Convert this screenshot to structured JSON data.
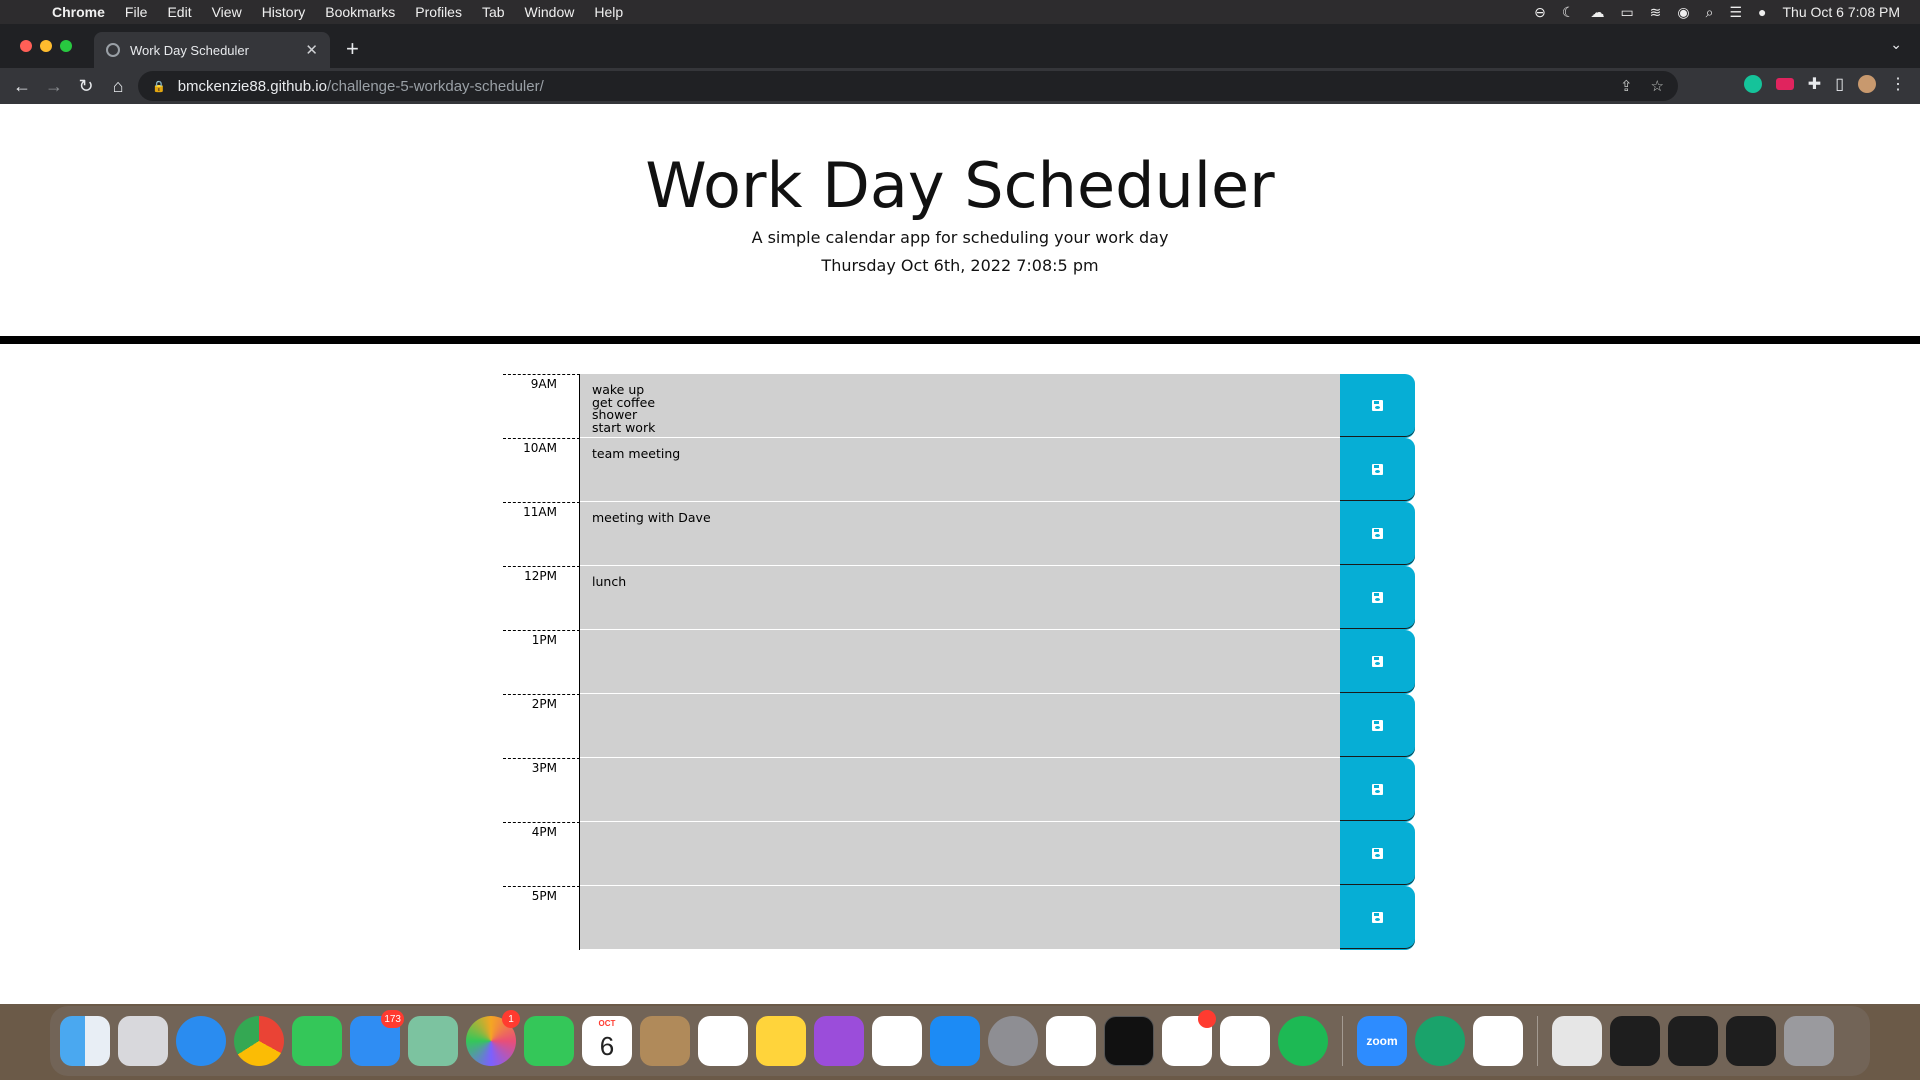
{
  "menubar": {
    "app_name": "Chrome",
    "items": [
      "File",
      "Edit",
      "View",
      "History",
      "Bookmarks",
      "Profiles",
      "Tab",
      "Window",
      "Help"
    ],
    "clock": "Thu Oct 6  7:08 PM"
  },
  "browser": {
    "tab_title": "Work Day Scheduler",
    "url_domain": "bmckenzie88.github.io",
    "url_path": "/challenge-5-workday-scheduler/"
  },
  "page": {
    "title": "Work Day Scheduler",
    "subtitle": "A simple calendar app for scheduling your work day",
    "datetime": "Thursday Oct 6th, 2022 7:08:5 pm"
  },
  "schedule": [
    {
      "hour": "9AM",
      "text": "wake up\nget coffee\nshower\nstart work"
    },
    {
      "hour": "10AM",
      "text": "team meeting"
    },
    {
      "hour": "11AM",
      "text": "meeting with Dave"
    },
    {
      "hour": "12PM",
      "text": "lunch"
    },
    {
      "hour": "1PM",
      "text": ""
    },
    {
      "hour": "2PM",
      "text": ""
    },
    {
      "hour": "3PM",
      "text": ""
    },
    {
      "hour": "4PM",
      "text": ""
    },
    {
      "hour": "5PM",
      "text": ""
    }
  ],
  "colors": {
    "save_button": "#06aed5",
    "row_background": "#d0d0d0",
    "header_border": "#000000"
  },
  "dock": {
    "mail_badge": "173",
    "photos_badge": "1",
    "calendar_month": "OCT",
    "calendar_day": "6",
    "zoom_label": "zoom"
  }
}
